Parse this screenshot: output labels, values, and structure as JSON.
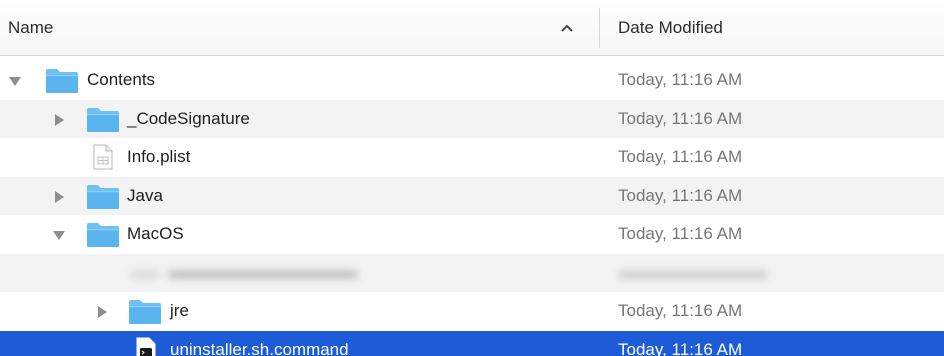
{
  "header": {
    "name_label": "Name",
    "date_label": "Date Modified",
    "sort_icon": "chevron-up-icon"
  },
  "rows": [
    {
      "name": "Contents",
      "date": "Today, 11:16 AM",
      "kind": "folder",
      "expanded": true
    },
    {
      "name": "_CodeSignature",
      "date": "Today, 11:16 AM",
      "kind": "folder",
      "expanded": false
    },
    {
      "name": "Info.plist",
      "date": "Today, 11:16 AM",
      "kind": "plist-file"
    },
    {
      "name": "Java",
      "date": "Today, 11:16 AM",
      "kind": "folder",
      "expanded": false
    },
    {
      "name": "MacOS",
      "date": "Today, 11:16 AM",
      "kind": "folder",
      "expanded": true
    },
    {
      "name": "",
      "date": "",
      "kind": "redacted-file"
    },
    {
      "name": "jre",
      "date": "Today, 11:16 AM",
      "kind": "folder",
      "expanded": false
    },
    {
      "name": "uninstaller.sh.command",
      "date": "Today, 11:16 AM",
      "kind": "executable-file",
      "selected": true
    }
  ],
  "colors": {
    "selection": "#1e5bd6",
    "folder": "#6fc1f3",
    "alt_row": "#f3f3f3"
  }
}
